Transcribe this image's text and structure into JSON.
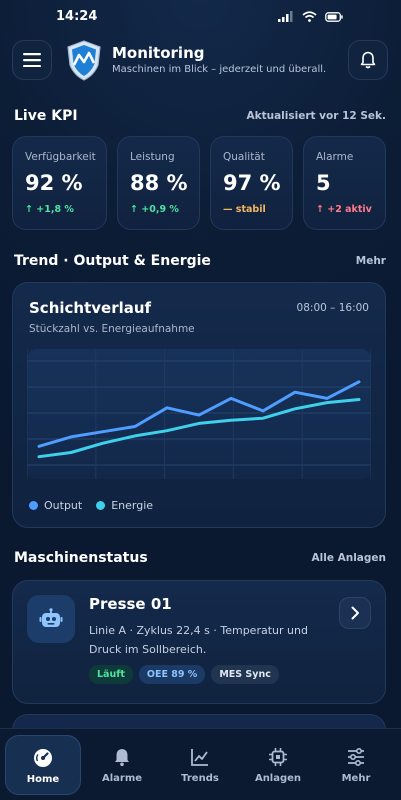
{
  "status_bar": {
    "time": "14:24"
  },
  "header": {
    "title": "Monitoring",
    "subtitle": "Maschinen im Blick – jederzeit und überall."
  },
  "kpi_section": {
    "title": "Live KPI",
    "updated": "Aktualisiert vor 12 Sek.",
    "cards": [
      {
        "label": "Verfügbarkeit",
        "value": "92 %",
        "delta": "↑ +1,8 %"
      },
      {
        "label": "Leistung",
        "value": "88 %",
        "delta": "↑ +0,9 %"
      },
      {
        "label": "Qualität",
        "value": "97 %",
        "delta": "— stabil"
      },
      {
        "label": "Alarme",
        "value": "5",
        "delta": "↑ +2 aktiv"
      }
    ]
  },
  "trend_section": {
    "title": "Trend · Output & Energie",
    "link": "Mehr",
    "card_title": "Schichtverlauf",
    "range": "08:00 – 16:00",
    "subtitle": "Stückzahl vs. Energieaufnahme",
    "legend_output": "Output",
    "legend_energy": "Energie"
  },
  "chart_data": {
    "type": "line",
    "x": [
      0,
      1,
      2,
      3,
      4,
      5,
      6,
      7,
      8,
      9,
      10
    ],
    "series": [
      {
        "name": "Output",
        "color": "#4f9dff",
        "values": [
          18,
          27,
          32,
          37,
          55,
          48,
          64,
          52,
          70,
          64,
          80
        ]
      },
      {
        "name": "Energie",
        "color": "#3fd0ec",
        "values": [
          8,
          12,
          21,
          28,
          33,
          40,
          43,
          45,
          54,
          60,
          63
        ]
      }
    ],
    "ylim": [
      0,
      100
    ],
    "grid": true
  },
  "machine_section": {
    "title": "Maschinenstatus",
    "link": "Alle Anlagen",
    "machines": [
      {
        "name": "Presse 01",
        "description": "Linie A · Zyklus 22,4 s · Temperatur und Druck im Sollbereich.",
        "badges": [
          "Läuft",
          "OEE 89 %",
          "MES Sync"
        ]
      }
    ]
  },
  "tabs": [
    {
      "label": "Home",
      "icon": "gauge-icon",
      "active": true
    },
    {
      "label": "Alarme",
      "icon": "bell-icon",
      "active": false
    },
    {
      "label": "Trends",
      "icon": "chart-line-icon",
      "active": false
    },
    {
      "label": "Anlagen",
      "icon": "chip-icon",
      "active": false
    },
    {
      "label": "Mehr",
      "icon": "sliders-icon",
      "active": false
    }
  ],
  "colors": {
    "background": "#0c1d36",
    "output": "#4f9dff",
    "energy": "#3fd0ec",
    "positive": "#4fe3a0",
    "warning": "#f4b860",
    "alert": "#ff7b8a"
  }
}
